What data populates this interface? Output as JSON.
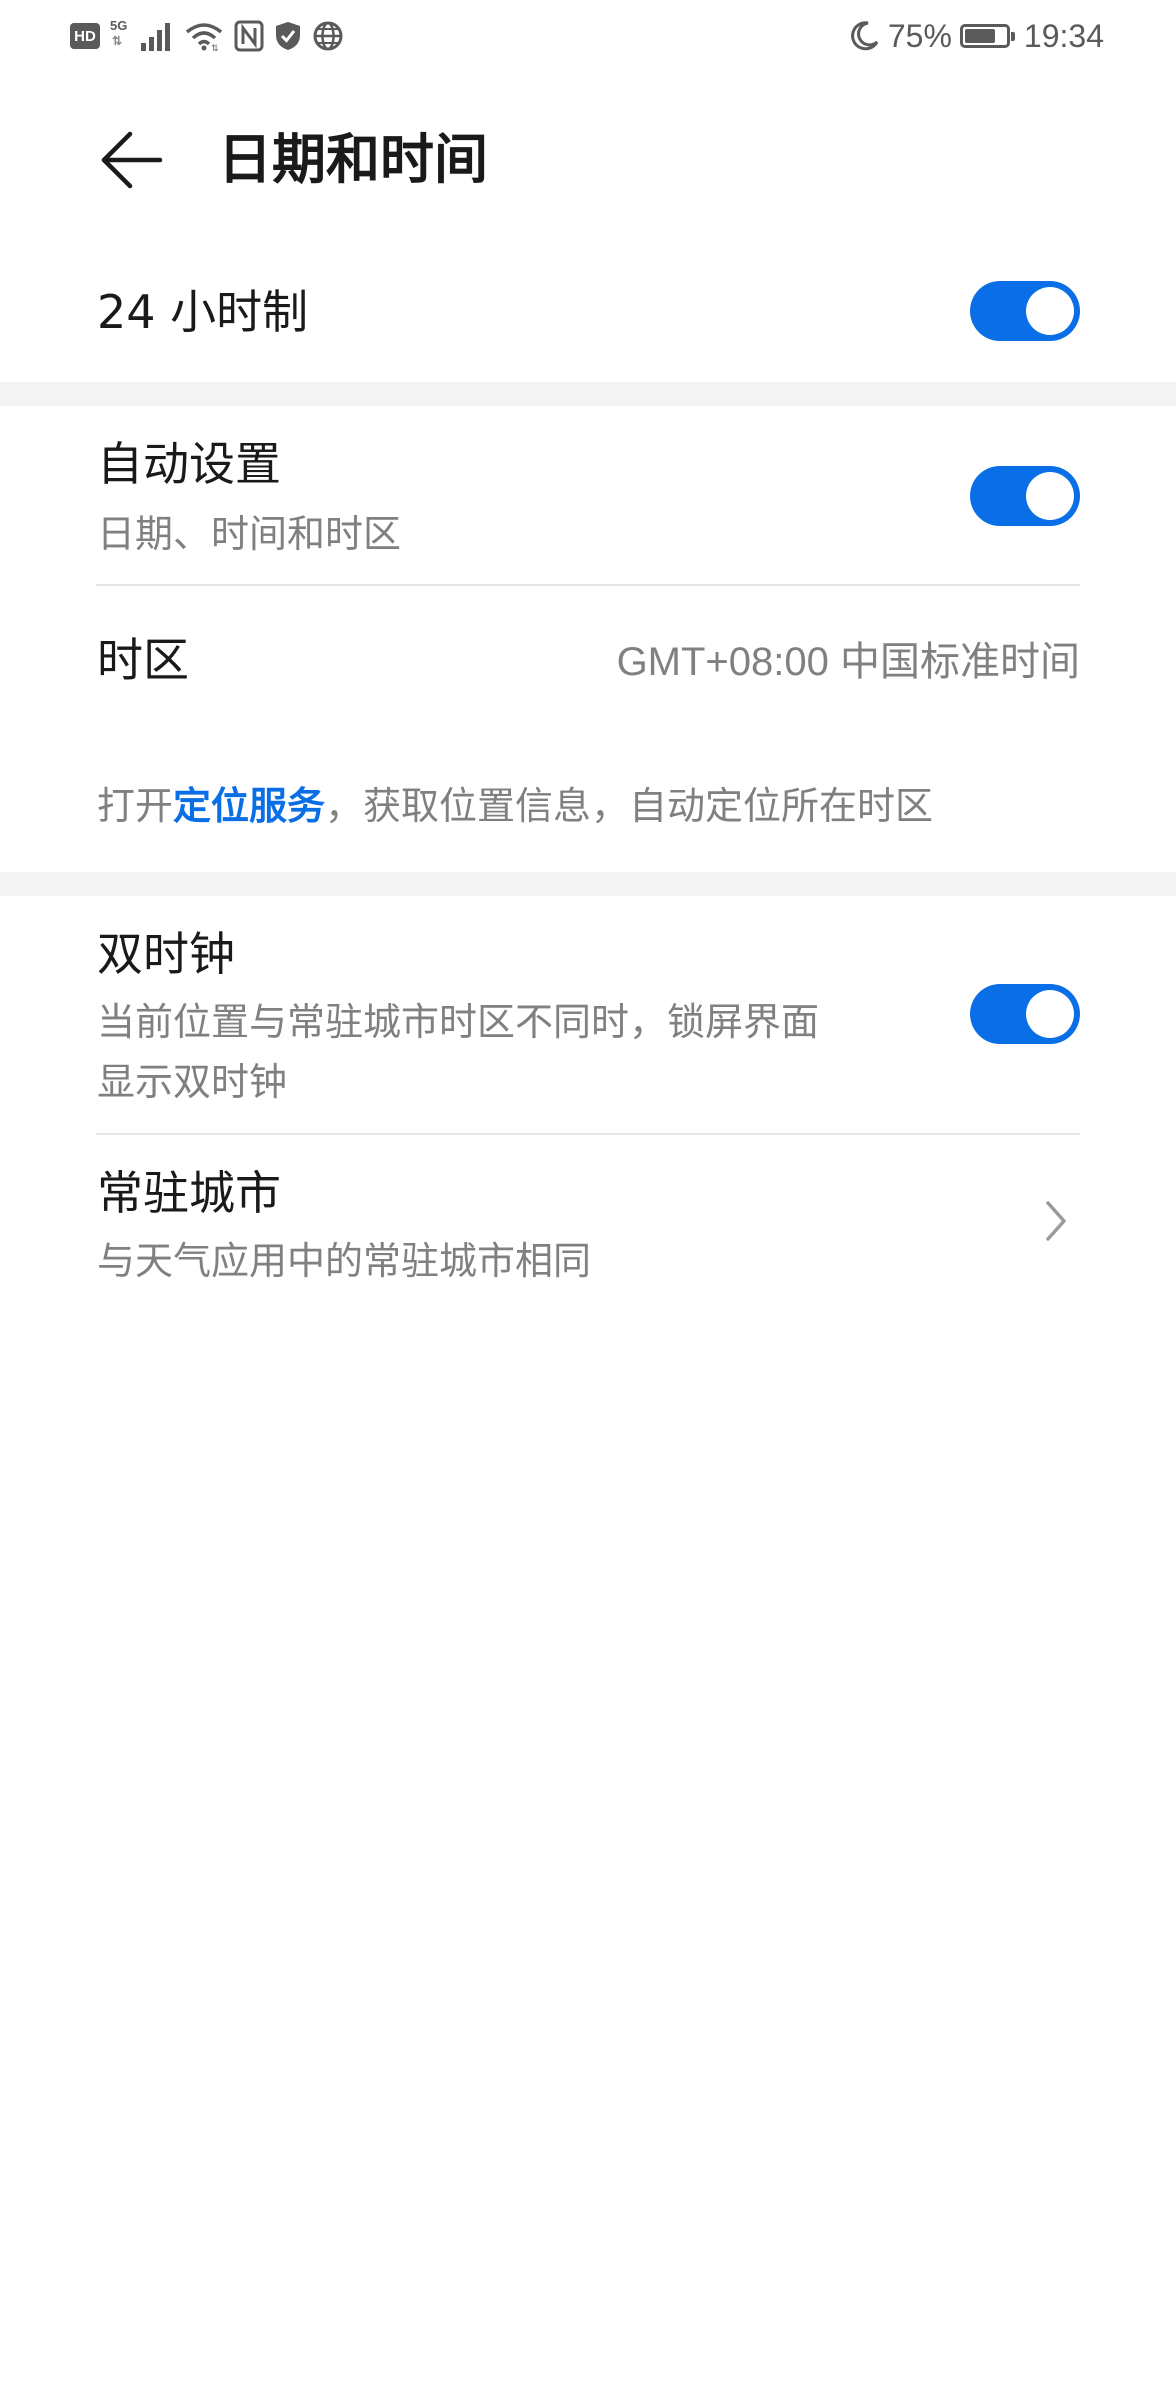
{
  "status_bar": {
    "hd": "HD",
    "network": "5G",
    "battery_text": "75%",
    "battery_level": 0.75,
    "time": "19:34",
    "icons": [
      "hd-badge",
      "signal-icon",
      "wifi-icon",
      "nfc-icon",
      "shield-icon",
      "globe-icon",
      "moon-icon",
      "battery-icon"
    ]
  },
  "header": {
    "title": "日期和时间",
    "back_icon": "back-arrow-icon"
  },
  "settings": {
    "hour24": {
      "title": "24 小时制",
      "enabled": true
    },
    "auto_set": {
      "title": "自动设置",
      "subtitle": "日期、时间和时区",
      "enabled": true
    },
    "timezone": {
      "title": "时区",
      "value": "GMT+08:00 中国标准时间"
    },
    "location_hint": {
      "prefix": "打开",
      "link": "定位服务",
      "suffix": "，获取位置信息，自动定位所在时区"
    },
    "dual_clock": {
      "title": "双时钟",
      "subtitle_line1": "当前位置与常驻城市时区不同时，锁屏界面",
      "subtitle_line2": "显示双时钟",
      "enabled": true
    },
    "home_city": {
      "title": "常驻城市",
      "subtitle": "与天气应用中的常驻城市相同"
    }
  },
  "colors": {
    "accent": "#0A6EE6",
    "text_primary": "#1A1A1A",
    "text_secondary": "#808080",
    "divider": "#E6E6E6",
    "section_bg": "#F4F4F4"
  }
}
